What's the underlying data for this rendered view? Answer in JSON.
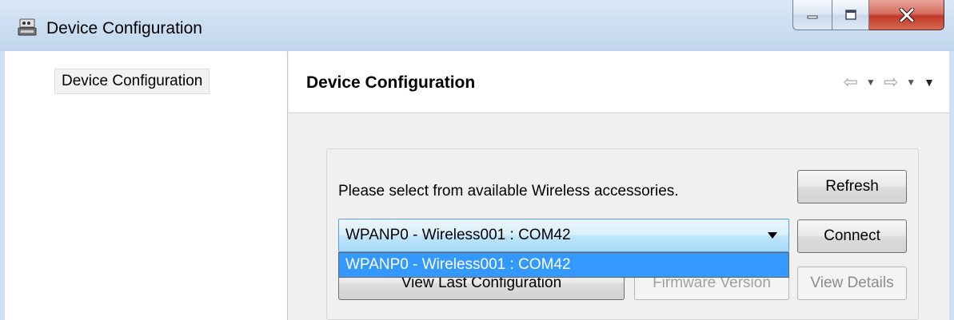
{
  "window": {
    "title": "Device Configuration",
    "app_icon": "device-config-icon",
    "controls": {
      "minimize_icon": "minimize-icon",
      "maximize_icon": "maximize-icon",
      "close_icon": "close-icon"
    }
  },
  "sidebar": {
    "items": [
      {
        "label": "Device Configuration",
        "selected": true
      }
    ]
  },
  "page": {
    "title": "Device Configuration",
    "nav_icons": [
      "back-arrow-icon",
      "dropdown-icon",
      "forward-arrow-icon",
      "dropdown-icon",
      "menu-dropdown-icon"
    ]
  },
  "content": {
    "instruction": "Please select from available Wireless accessories.",
    "refresh_label": "Refresh",
    "connect_label": "Connect",
    "accessory_select": {
      "value": "WPANP0 - Wireless001 : COM42",
      "options": [
        "WPANP0 - Wireless001 : COM42"
      ]
    },
    "view_last_label": "View Last Configuration",
    "firmware_label": "Firmware Version",
    "view_details_label": "View Details"
  },
  "colors": {
    "highlight": "#3399ff",
    "combo_border": "#569de5",
    "close_button": "#c3382a",
    "titlebar": "#cddff2"
  }
}
